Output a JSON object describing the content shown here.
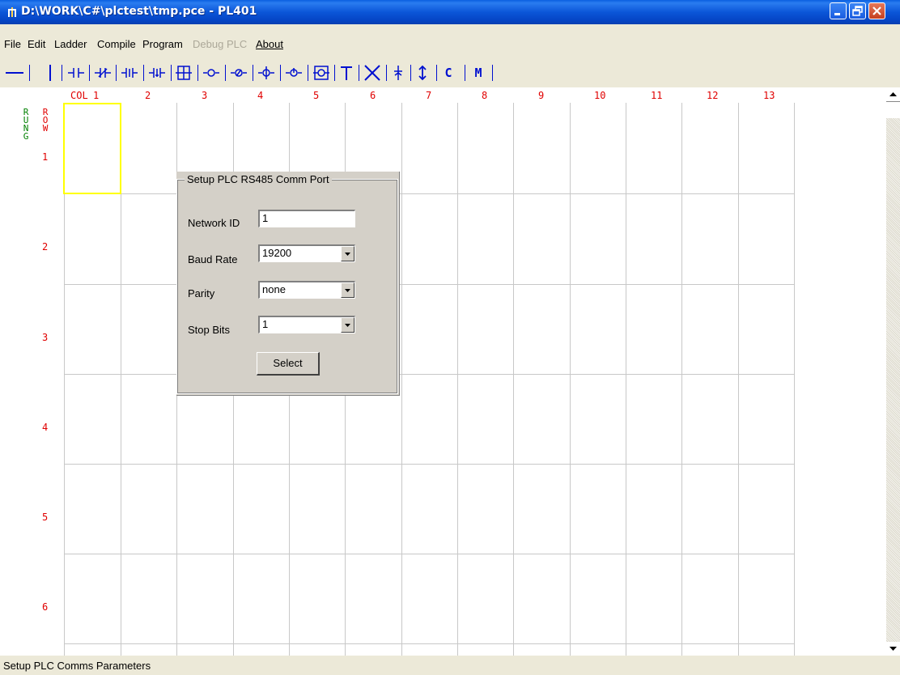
{
  "window": {
    "title": "D:\\WORK\\C#\\plctest\\tmp.pce - PL401"
  },
  "menu": [
    {
      "label": "File",
      "enabled": true
    },
    {
      "label": "Edit",
      "enabled": true
    },
    {
      "label": "Ladder",
      "enabled": true
    },
    {
      "label": "Compile",
      "enabled": true
    },
    {
      "label": "Program",
      "enabled": true
    },
    {
      "label": "Debug",
      "enabled": false
    },
    {
      "label": "PLC",
      "enabled": false
    },
    {
      "label": "About",
      "enabled": true
    }
  ],
  "toolbar": {
    "tools": [
      "horizontal-line-tool-icon",
      "vertical-line-tool-icon",
      "no-contact-tool-icon",
      "nc-contact-tool-icon",
      "rising-edge-contact-tool-icon",
      "falling-edge-contact-tool-icon",
      "box-function-tool-icon",
      "coil-tool-icon",
      "negated-coil-tool-icon",
      "set-coil-tool-icon",
      "reset-coil-tool-icon",
      "function-coil-tool-icon",
      "branch-t-tool-icon",
      "delete-x-tool-icon",
      "vertical-connect-tool-icon",
      "vertical-updown-tool-icon"
    ],
    "text_tools": [
      "C",
      "M"
    ]
  },
  "grid": {
    "col_header": "COL",
    "columns": [
      "1",
      "2",
      "3",
      "4",
      "5",
      "6",
      "7",
      "8",
      "9",
      "10",
      "11",
      "12",
      "13"
    ],
    "rows": [
      "1",
      "2",
      "3",
      "4",
      "5",
      "6"
    ],
    "rung_label": "RUNG",
    "row_label": "ROW",
    "colors": {
      "rung": "#008000",
      "row": "#e00000",
      "selection": "#ffff00",
      "gridline": "#c8c8c8"
    }
  },
  "dialog": {
    "title": "Setup PLC RS485 Comm Port",
    "network_id_label": "Network ID",
    "network_id_value": "1",
    "baud_rate_label": "Baud Rate",
    "baud_rate_value": "19200",
    "parity_label": "Parity",
    "parity_value": "none",
    "stop_bits_label": "Stop Bits",
    "stop_bits_value": "1",
    "select_label": "Select"
  },
  "status": {
    "text": "Setup PLC Comms Parameters"
  }
}
